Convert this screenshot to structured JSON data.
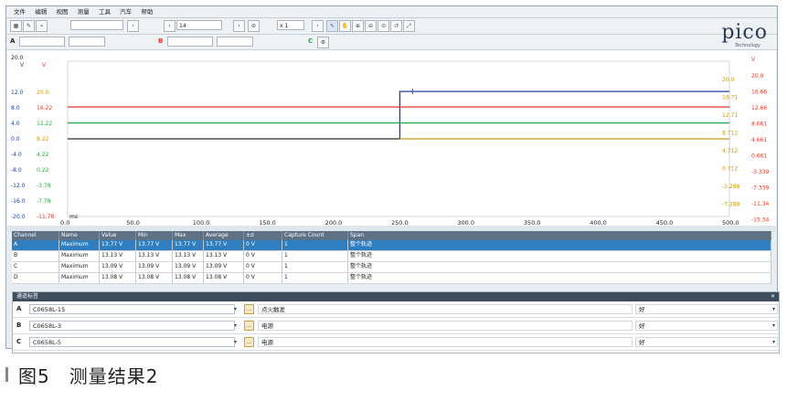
{
  "menu": [
    "文件",
    "编辑",
    "视图",
    "测量",
    "工具",
    "汽车",
    "帮助"
  ],
  "toolbar": {
    "samples": "14",
    "zoom": "x 1",
    "channel_a": "A",
    "channel_b": "B",
    "channel_c": "C",
    "channel_d": "D"
  },
  "logo": {
    "brand": "pico",
    "sub": "Technology"
  },
  "scope": {
    "time_unit": "ms",
    "x_ticks": [
      "0.0",
      "50.0",
      "100.0",
      "150.0",
      "200.0",
      "250.0",
      "300.0",
      "350.0",
      "400.0",
      "450.0",
      "500.0"
    ],
    "axis_a": {
      "unit": "V",
      "top": "20.0",
      "ticks": [
        "12.0",
        "8.0",
        "4.0",
        "0.0",
        "-4.0",
        "-8.0",
        "-12.0",
        "-16.0",
        "-20.0"
      ]
    },
    "axis_b": {
      "unit": "V",
      "ticks": [
        "20.0",
        "16.22",
        "12.22",
        "8.22",
        "4.22",
        "0.22",
        "-3.78",
        "-7.78",
        "-11.78"
      ]
    },
    "axis_c": {
      "unit": "V",
      "ticks": [
        "20.0",
        "16.71",
        "12.71",
        "8.712",
        "4.712",
        "0.712",
        "-3.288",
        "-7.288"
      ]
    },
    "axis_d": {
      "unit": "V",
      "ticks": [
        "20.0",
        "16.66",
        "12.66",
        "8.661",
        "4.661",
        "0.661",
        "-3.339",
        "-7.339",
        "-11.34",
        "-15.34"
      ]
    },
    "colors": {
      "a": "#1f3fa0",
      "b": "#e03a2a",
      "c": "#2da54a",
      "d": "#c99a10"
    }
  },
  "table": {
    "headers": [
      "Channel",
      "Name",
      "Value",
      "Min",
      "Max",
      "Average",
      "±σ",
      "Capture Count",
      "Span"
    ],
    "rows": [
      [
        "A",
        "Maximum",
        "13.77 V",
        "13.77 V",
        "13.77 V",
        "13.77 V",
        "0 V",
        "1",
        "整个轨迹"
      ],
      [
        "B",
        "Maximum",
        "13.13 V",
        "13.13 V",
        "13.13 V",
        "13.13 V",
        "0 V",
        "1",
        "整个轨迹"
      ],
      [
        "C",
        "Maximum",
        "13.09 V",
        "13.09 V",
        "13.09 V",
        "13.09 V",
        "0 V",
        "1",
        "整个轨迹"
      ],
      [
        "D",
        "Maximum",
        "13.08 V",
        "13.08 V",
        "13.08 V",
        "13.08 V",
        "0 V",
        "1",
        "整个轨迹"
      ]
    ]
  },
  "probes": {
    "title": "通道标签",
    "rows": [
      {
        "channel": "A",
        "probe": "C0658L-15",
        "desc": "点火触发",
        "quality": "好"
      },
      {
        "channel": "B",
        "probe": "C0658L-3",
        "desc": "电源",
        "quality": "好"
      },
      {
        "channel": "C",
        "probe": "C0658L-5",
        "desc": "电源",
        "quality": "好"
      }
    ]
  },
  "caption": "图5　测量结果2"
}
